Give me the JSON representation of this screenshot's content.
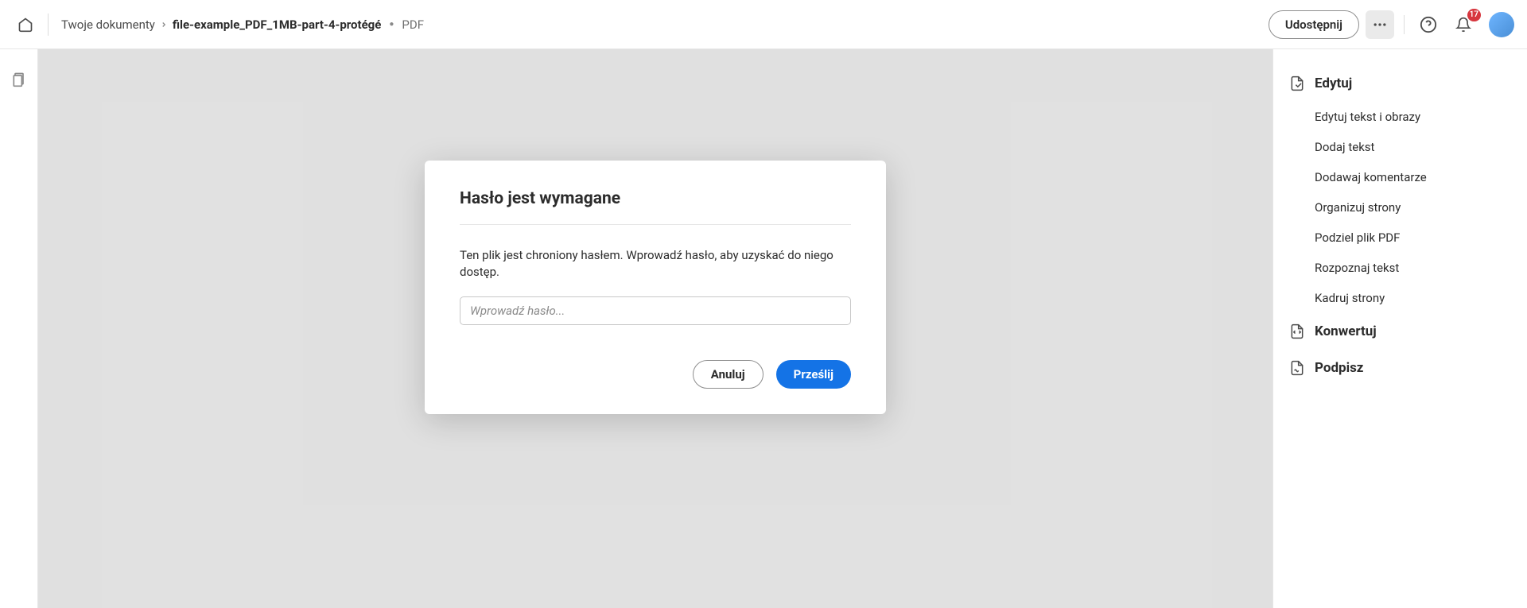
{
  "breadcrumb": {
    "root": "Twoje dokumenty",
    "filename": "file-example_PDF_1MB-part-4-protégé",
    "type": "PDF"
  },
  "topbar": {
    "share": "Udostępnij",
    "notification_count": "17"
  },
  "modal": {
    "title": "Hasło jest wymagane",
    "body": "Ten plik jest chroniony hasłem. Wprowadź hasło, aby uzyskać do niego dostęp.",
    "placeholder": "Wprowadź hasło...",
    "cancel": "Anuluj",
    "submit": "Prześlij"
  },
  "sidebar": {
    "edit": {
      "title": "Edytuj",
      "items": [
        "Edytuj tekst i obrazy",
        "Dodaj tekst",
        "Dodawaj komentarze",
        "Organizuj strony",
        "Podziel plik PDF",
        "Rozpoznaj tekst",
        "Kadruj strony"
      ]
    },
    "convert": {
      "title": "Konwertuj"
    },
    "sign": {
      "title": "Podpisz"
    }
  }
}
